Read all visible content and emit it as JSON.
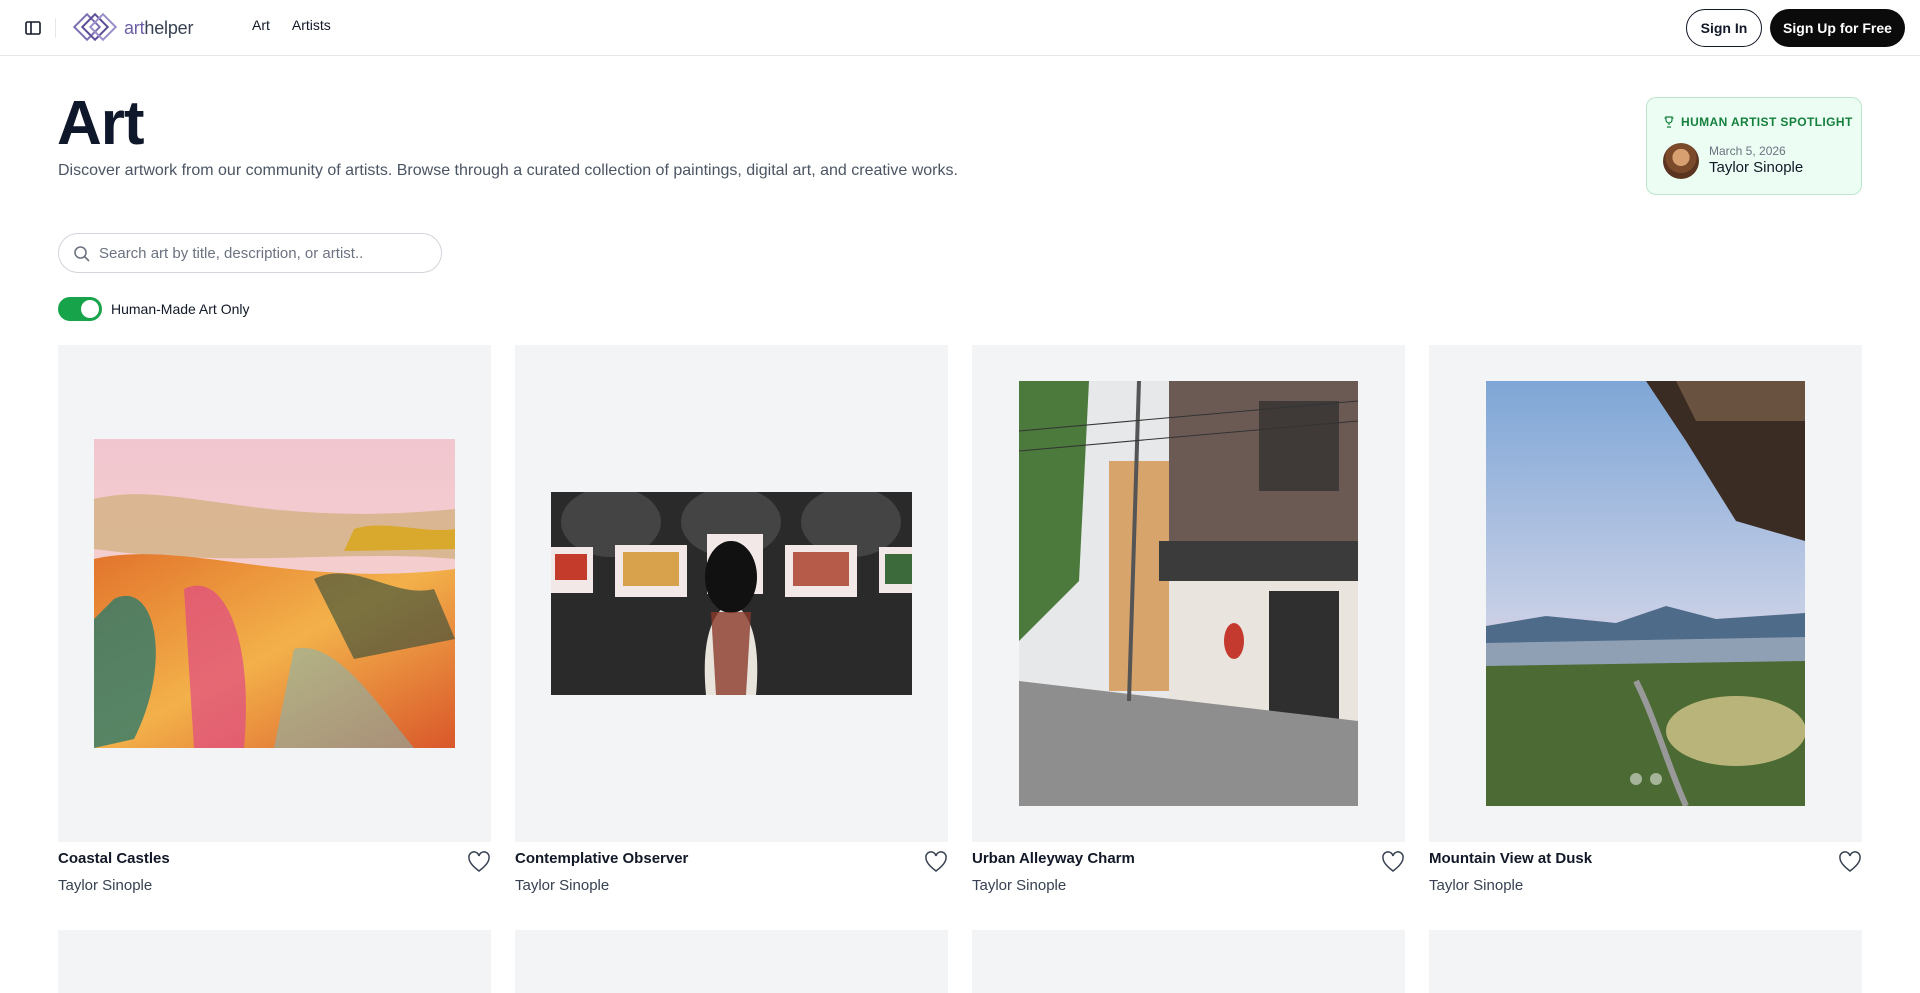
{
  "header": {
    "logo_prefix": "art",
    "logo_suffix": "helper",
    "nav": [
      "Art",
      "Artists"
    ],
    "sign_in": "Sign In",
    "sign_up": "Sign Up for Free"
  },
  "hero": {
    "title": "Art",
    "subtitle": "Discover artwork from our community of artists. Browse through a curated collection of paintings, digital art, and creative works."
  },
  "spotlight": {
    "label": "HUMAN ARTIST SPOTLIGHT",
    "date": "March 5, 2026",
    "name": "Taylor Sinople"
  },
  "search": {
    "placeholder": "Search art by title, description, or artist.."
  },
  "filter": {
    "label": "Human-Made Art Only",
    "enabled": true
  },
  "artworks": [
    {
      "title": "Coastal Castles",
      "artist": "Taylor Sinople",
      "image": "abstract-landscape-painting"
    },
    {
      "title": "Contemplative Observer",
      "artist": "Taylor Sinople",
      "image": "gallery-visitor-photo"
    },
    {
      "title": "Urban Alleyway Charm",
      "artist": "Taylor Sinople",
      "image": "japanese-alley-photo"
    },
    {
      "title": "Mountain View at Dusk",
      "artist": "Taylor Sinople",
      "image": "mountain-dusk-photo"
    }
  ],
  "colors": {
    "accent": "#16a34a",
    "brand": "#6d5ea8",
    "primary_button": "#0b0b0b"
  }
}
